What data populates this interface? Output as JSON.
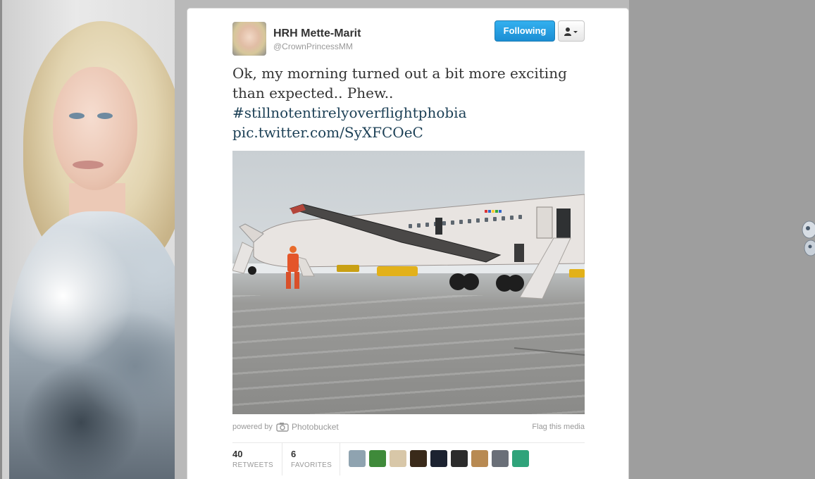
{
  "tweet": {
    "display_name": "HRH Mette-Marit",
    "screen_name": "@CrownPrincessMM",
    "follow_label": "Following",
    "user_menu_icon": "person-dropdown-icon",
    "text_line1": "Ok, my morning turned out a bit more exciting than expected.. Phew..",
    "hashtag": "#stillnotentirelyoverflightphobia",
    "pic_link": "pic.twitter.com/SyXFCOeC"
  },
  "media": {
    "powered_by": "powered by",
    "provider_icon": "camera-icon",
    "provider": "Photobucket",
    "flag": "Flag this media"
  },
  "stats": {
    "retweets_count": "40",
    "retweets_label": "RETWEETS",
    "favorites_count": "6",
    "favorites_label": "FAVORITES"
  },
  "favoriters": [
    {
      "color": "#8fa3b0"
    },
    {
      "color": "#3f8a3a"
    },
    {
      "color": "#d8c7a8"
    },
    {
      "color": "#3a2a1a"
    },
    {
      "color": "#1c2230"
    },
    {
      "color": "#2c2c2c"
    },
    {
      "color": "#b88a52"
    },
    {
      "color": "#6a6f78"
    },
    {
      "color": "#2fa37a"
    }
  ],
  "colors": {
    "follow_button": "#1b8ed4",
    "link": "#1b3f55",
    "text": "#333333"
  }
}
